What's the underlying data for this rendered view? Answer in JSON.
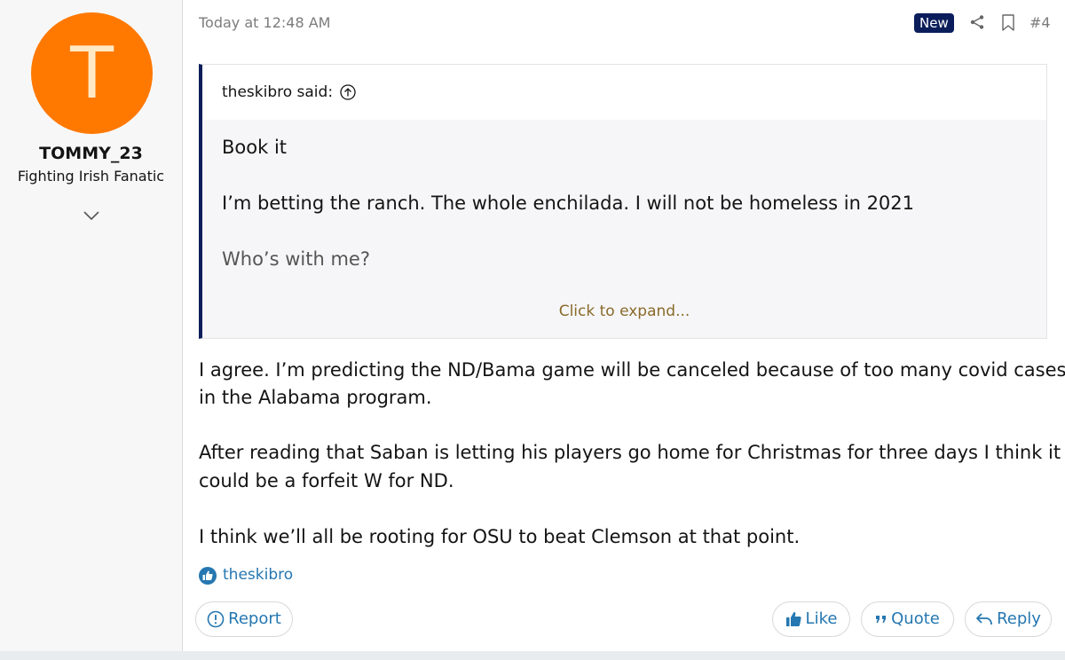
{
  "user": {
    "avatar_letter": "T",
    "avatar_color": "#ff7800",
    "username": "TOMMY_23",
    "title": "Fighting Irish Fanatic"
  },
  "post": {
    "date": "Today at 12:48 AM",
    "badge": "New",
    "number": "#4",
    "quote": {
      "author": "theskibro said:",
      "lines": [
        "Book it",
        "I’m betting the ranch. The whole enchilada. I will not be homeless in 2021",
        "Who’s with me?"
      ],
      "expand": "Click to expand..."
    },
    "body": [
      "I agree. I’m predicting the ND/Bama game will be canceled because of too many covid cases",
      "in the Alabama program.",
      "After reading that Saban is letting his players go home for Christmas for three days I think it",
      "could be a forfeit W for ND.",
      "I think we’ll all be rooting for OSU to beat Clemson at that point."
    ],
    "reaction_user": "theskibro"
  },
  "actions": {
    "report": "Report",
    "like": "Like",
    "quote": "Quote",
    "reply": "Reply"
  },
  "colors": {
    "accent": "#2577b1",
    "quote_border": "#0b1e5b",
    "expand_link": "#8a6a2a"
  }
}
